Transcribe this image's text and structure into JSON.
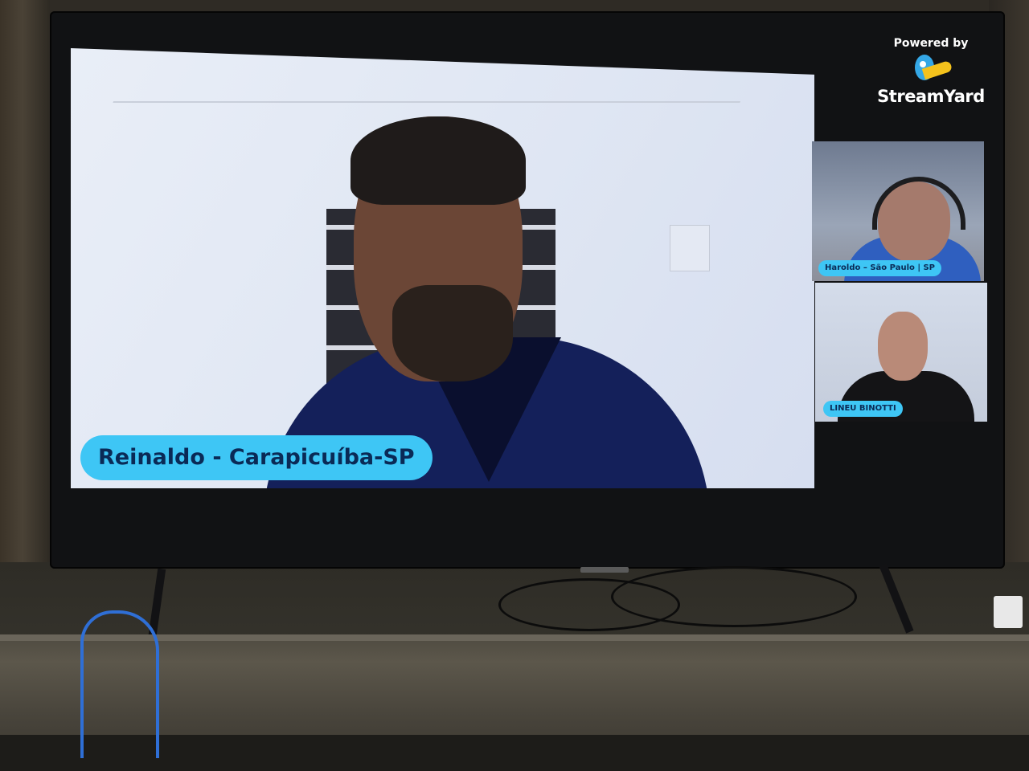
{
  "main_video": {
    "name_label": "Reinaldo - Carapicuíba-SP"
  },
  "branding": {
    "powered_by": "Powered by",
    "name": "StreamYard"
  },
  "participants": [
    {
      "label": "Haroldo – São Paulo | SP"
    },
    {
      "label": "LINEU BINOTTI"
    }
  ],
  "colors": {
    "label_background": "#3ec6f5",
    "label_text": "#0a2a56"
  }
}
